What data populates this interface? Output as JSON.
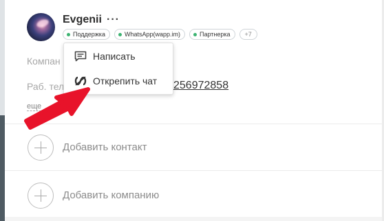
{
  "contact": {
    "name": "Evgenii",
    "more": "···",
    "tags": [
      {
        "label": "Поддержка"
      },
      {
        "label": "WhatsApp(wapp.im)"
      },
      {
        "label": "Партнерка"
      }
    ],
    "extra_tags": "+7"
  },
  "fields": {
    "company_label": "Компан",
    "phone_label": "Раб. тел",
    "phone_value": "256972858",
    "more_link": "еще"
  },
  "menu": {
    "items": [
      {
        "label": "Написать",
        "icon": "message-icon"
      },
      {
        "label": "Открепить чат",
        "icon": "unpin-icon"
      }
    ]
  },
  "actions": {
    "add_contact": "Добавить контакт",
    "add_company": "Добавить компанию"
  },
  "colors": {
    "tag_dot": "#3cb371",
    "arrow": "#e8132a"
  }
}
